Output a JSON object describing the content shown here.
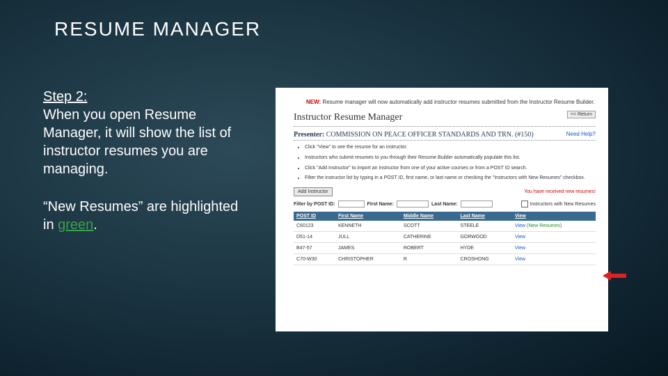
{
  "slide": {
    "title": "RESUME MANAGER",
    "step_label": "Step 2:",
    "paragraph1": "When you open Resume Manager, it will show the list of instructor resumes you are managing.",
    "paragraph2_a": "“New Resumes” are highlighted in ",
    "paragraph2_green": "green",
    "paragraph2_b": "."
  },
  "screenshot": {
    "new_label": "NEW:",
    "new_text": "Resume manager will now automatically add instructor resumes submitted from the Instructor Resume Builder.",
    "section_heading": "Instructor Resume Manager",
    "return_button": "<< Return",
    "presenter_label": "Presenter:",
    "presenter_name": "COMMISSION ON PEACE OFFICER STANDARDS AND TRN.",
    "presenter_id": "(#150)",
    "need_help": "Need Help?",
    "bullets": [
      "Click \"View\" to see the resume for an instructor.",
      "Instructors who submit resumes to you through their Resume Builder automatically populate this list.",
      "Click \"Add Instructor\" to import an instructor from one of your active courses or from a POST ID search.",
      "Filter the instructor list by typing in a POST ID, first name, or last name or checking the \"Instructors with New Resumes\" checkbox."
    ],
    "add_button": "Add Instructor",
    "received_msg": "You have received new resumes!",
    "filter": {
      "post_id_label": "Filter by POST ID:",
      "first_name_label": "First Name:",
      "last_name_label": "Last Name:",
      "checkbox_label": "Instructors with New Resumes"
    },
    "table": {
      "headers": {
        "post_id": "POST ID",
        "first": "First Name",
        "middle": "Middle Name",
        "last": "Last Name",
        "view": "View"
      },
      "rows": [
        {
          "post_id": "C60123",
          "first": "KENNETH",
          "middle": "SCOTT",
          "last": "STEELE",
          "view": "View",
          "new_resume": "(New Resumes)"
        },
        {
          "post_id": "D51-14",
          "first": "JULL",
          "middle": "CATHERINE",
          "last": "GORWOOD",
          "view": "View",
          "new_resume": ""
        },
        {
          "post_id": "B47-57",
          "first": "JAMES",
          "middle": "ROBERT",
          "last": "HYDE",
          "view": "View",
          "new_resume": ""
        },
        {
          "post_id": "C70-W30",
          "first": "CHRISTOPHER",
          "middle": "R",
          "last": "CROSHONG",
          "view": "View",
          "new_resume": ""
        }
      ]
    }
  }
}
